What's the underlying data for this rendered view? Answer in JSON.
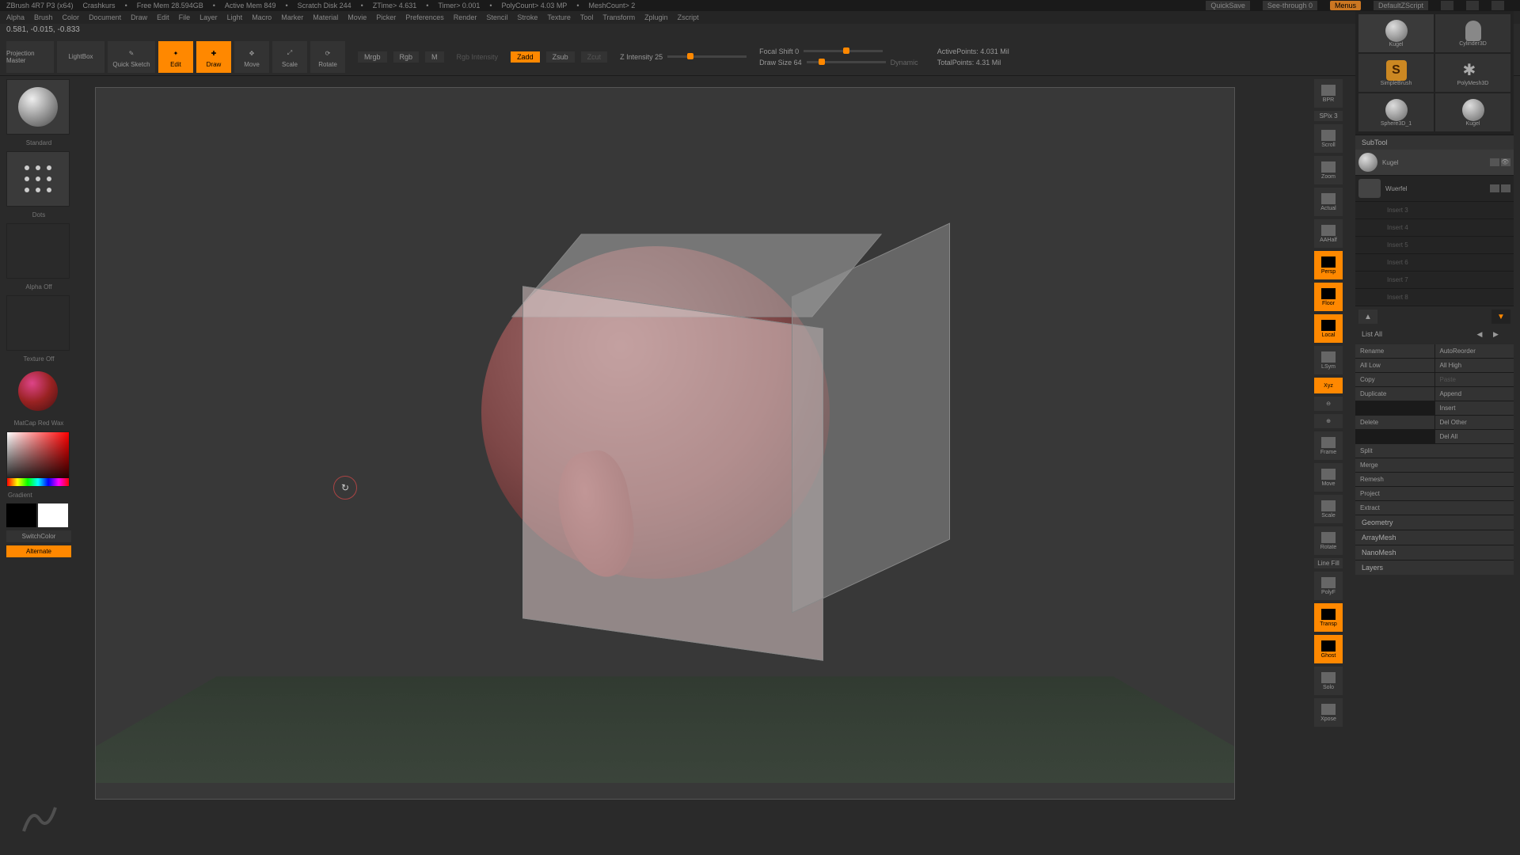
{
  "titlebar": {
    "app": "ZBrush 4R7 P3 (x64)",
    "project": "Crashkurs",
    "stats": [
      "Free Mem 28.594GB",
      "Active Mem 849",
      "Scratch Disk 244",
      "ZTime> 4.631",
      "Timer> 0.001",
      "PolyCount> 4.03 MP",
      "MeshCount> 2"
    ],
    "quicksave": "QuickSave",
    "seethrough": "See-through  0",
    "menus": "Menus",
    "defaultscript": "DefaultZScript"
  },
  "menubar": [
    "Alpha",
    "Brush",
    "Color",
    "Document",
    "Draw",
    "Edit",
    "File",
    "Layer",
    "Light",
    "Macro",
    "Marker",
    "Material",
    "Movie",
    "Picker",
    "Preferences",
    "Render",
    "Stencil",
    "Stroke",
    "Texture",
    "Tool",
    "Transform",
    "Zplugin",
    "Zscript"
  ],
  "coords": "0.581, -0.015, -0.833",
  "toolbar": {
    "projection": "Projection\nMaster",
    "lightbox": "LightBox",
    "quicksketch": "Quick Sketch",
    "edit": "Edit",
    "draw": "Draw",
    "move": "Move",
    "scale": "Scale",
    "rotate": "Rotate",
    "mrgb": "Mrgb",
    "rgb": "Rgb",
    "m": "M",
    "rgb_intensity": "Rgb Intensity",
    "zadd": "Zadd",
    "zsub": "Zsub",
    "zcut": "Zcut",
    "z_intensity": "Z Intensity 25",
    "focal_shift": "Focal Shift 0",
    "draw_size": "Draw Size 64",
    "dynamic": "Dynamic",
    "active_points": "ActivePoints: 4.031 Mil",
    "total_points": "TotalPoints: 4.31 Mil"
  },
  "left": {
    "brush": "Standard",
    "stroke": "Dots",
    "alpha": "Alpha Off",
    "texture": "Texture Off",
    "material": "MatCap Red Wax",
    "gradient": "Gradient",
    "switchcolor": "SwitchColor",
    "alternate": "Alternate"
  },
  "rightnav": {
    "spix": "SPix 3",
    "bpr": "BPR",
    "scroll": "Scroll",
    "zoom": "Zoom",
    "actual": "Actual",
    "aahalf": "AAHalf",
    "persp": "Persp",
    "floor": "Floor",
    "local": "Local",
    "lsym": "LSym",
    "xyz": "Xyz",
    "frame": "Frame",
    "move": "Move",
    "scale": "Scale",
    "rotate": "Rotate",
    "linefill": "Line Fill",
    "polyf": "PolyF",
    "transp": "Transp",
    "ghost": "Ghost",
    "solo": "Solo",
    "xpose": "Xpose"
  },
  "tools": {
    "items": [
      {
        "label": "Kugel"
      },
      {
        "label": "Cylinder3D"
      },
      {
        "label": "SimpleBrush"
      },
      {
        "label": "PolyMesh3D"
      },
      {
        "label": "Sphere3D_1"
      },
      {
        "label": "Kugel"
      }
    ]
  },
  "subtool": {
    "header": "SubTool",
    "items": [
      {
        "name": "Kugel",
        "active": true
      },
      {
        "name": "Wuerfel",
        "active": false
      }
    ],
    "empty": [
      "Insert 3",
      "Insert 4",
      "Insert 5",
      "Insert 6",
      "Insert 7",
      "Insert 8"
    ],
    "listall": "List All",
    "actions": {
      "rename": "Rename",
      "autoreorder": "AutoReorder",
      "alllow": "All Low",
      "allhigh": "All High",
      "copy": "Copy",
      "paste": "Paste",
      "duplicate": "Duplicate",
      "append": "Append",
      "insert": "Insert",
      "delete": "Delete",
      "delother": "Del Other",
      "delall": "Del All",
      "split": "Split",
      "merge": "Merge",
      "remesh": "Remesh",
      "project": "Project",
      "extract": "Extract"
    },
    "sections": [
      "Geometry",
      "ArrayMesh",
      "NanoMesh",
      "Layers"
    ]
  }
}
